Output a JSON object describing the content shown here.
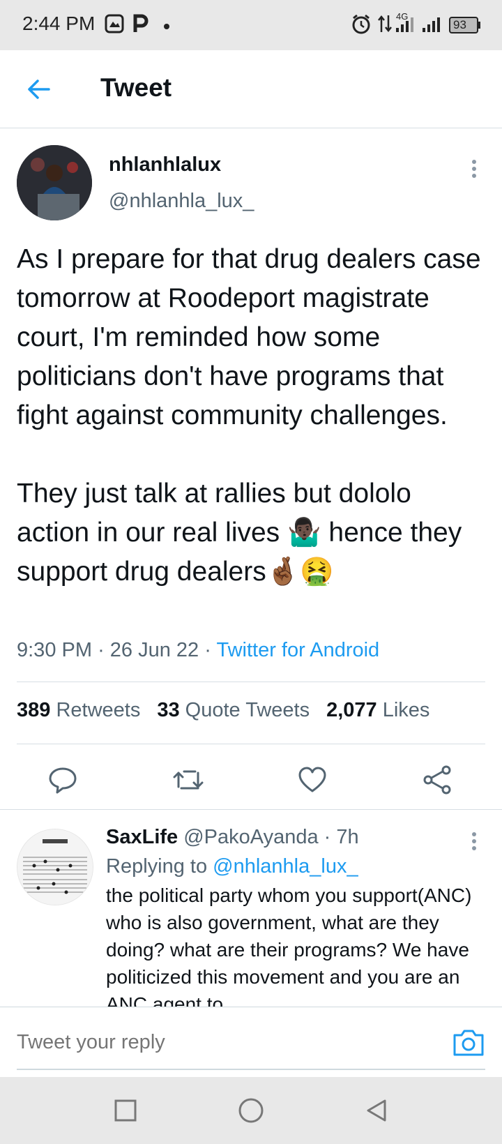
{
  "status_bar": {
    "time": "2:44 PM",
    "network": "4G",
    "battery": "93",
    "icons": [
      "photo-icon",
      "parking-icon",
      "dot-icon",
      "alarm-icon",
      "data-arrows-icon",
      "signal-icon",
      "signal-icon",
      "battery-icon"
    ]
  },
  "app_bar": {
    "title": "Tweet"
  },
  "tweet": {
    "display_name": "nhlanhlalux",
    "handle": "@nhlanhla_lux_",
    "text": "As I prepare for that drug dealers case tomorrow at Roodeport magistrate court, I'm reminded how some politicians don't have programs that fight against community challenges.\n\nThey just talk at rallies but dololo action in our real lives 🤷🏿‍♂️ hence they support drug dealers🤞🏾🤮",
    "time": "9:30 PM",
    "date": "26 Jun 22",
    "separator": "·",
    "source": "Twitter for Android",
    "stats": {
      "retweets_count": "389",
      "retweets_label": "Retweets",
      "quotes_count": "33",
      "quotes_label": "Quote Tweets",
      "likes_count": "2,077",
      "likes_label": "Likes"
    }
  },
  "reply": {
    "display_name": "SaxLife",
    "handle": "@PakoAyanda",
    "separator": "·",
    "age": "7h",
    "replying_prefix": "Replying to",
    "replying_to": "@nhlanhla_lux_",
    "text": "the political party whom you support(ANC) who is also government, what are they doing? what are their programs? We have politicized this movement and you are an ANC agent to"
  },
  "composer": {
    "placeholder": "Tweet your reply"
  },
  "colors": {
    "accent": "#1d9bf0",
    "secondary_text": "#536471",
    "divider": "#d7dee3"
  }
}
